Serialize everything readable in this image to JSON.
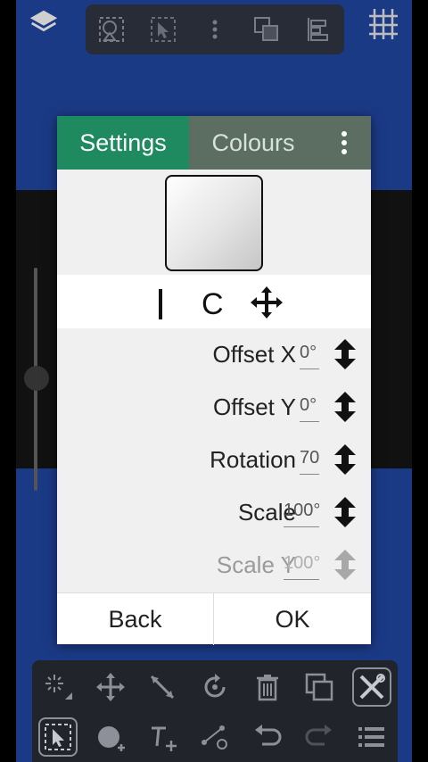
{
  "dialog": {
    "tabs": {
      "settings": "Settings",
      "colours": "Colours"
    },
    "mode_letter": "C",
    "fields": [
      {
        "label": "Offset X",
        "value": "0°",
        "disabled": false
      },
      {
        "label": "Offset Y",
        "value": "0°",
        "disabled": false
      },
      {
        "label": "Rotation",
        "value": "70°",
        "disabled": false
      },
      {
        "label": "Scale",
        "value": "100°",
        "disabled": false
      },
      {
        "label": "Scale Y",
        "value": "100°",
        "disabled": true
      }
    ],
    "back_label": "Back",
    "ok_label": "OK"
  },
  "colors": {
    "active_tab": "#1f8a5f",
    "tab_bar": "#5c6e61",
    "canvas": "#1b3a86",
    "toolbar": "#222222"
  },
  "icons": {
    "top_toolbar": [
      "transparency-icon",
      "selection-icon",
      "more-vertical-icon",
      "duplicate-layer-icon",
      "align-icon"
    ],
    "bottom_row1": [
      "magic-wand-icon",
      "move-icon",
      "line-icon",
      "rotate-icon",
      "trash-icon",
      "copy-icon",
      "tools-icon"
    ],
    "bottom_row2": [
      "select-icon",
      "fill-icon",
      "text-icon",
      "nodes-icon",
      "undo-icon",
      "redo-icon",
      "list-icon"
    ]
  }
}
